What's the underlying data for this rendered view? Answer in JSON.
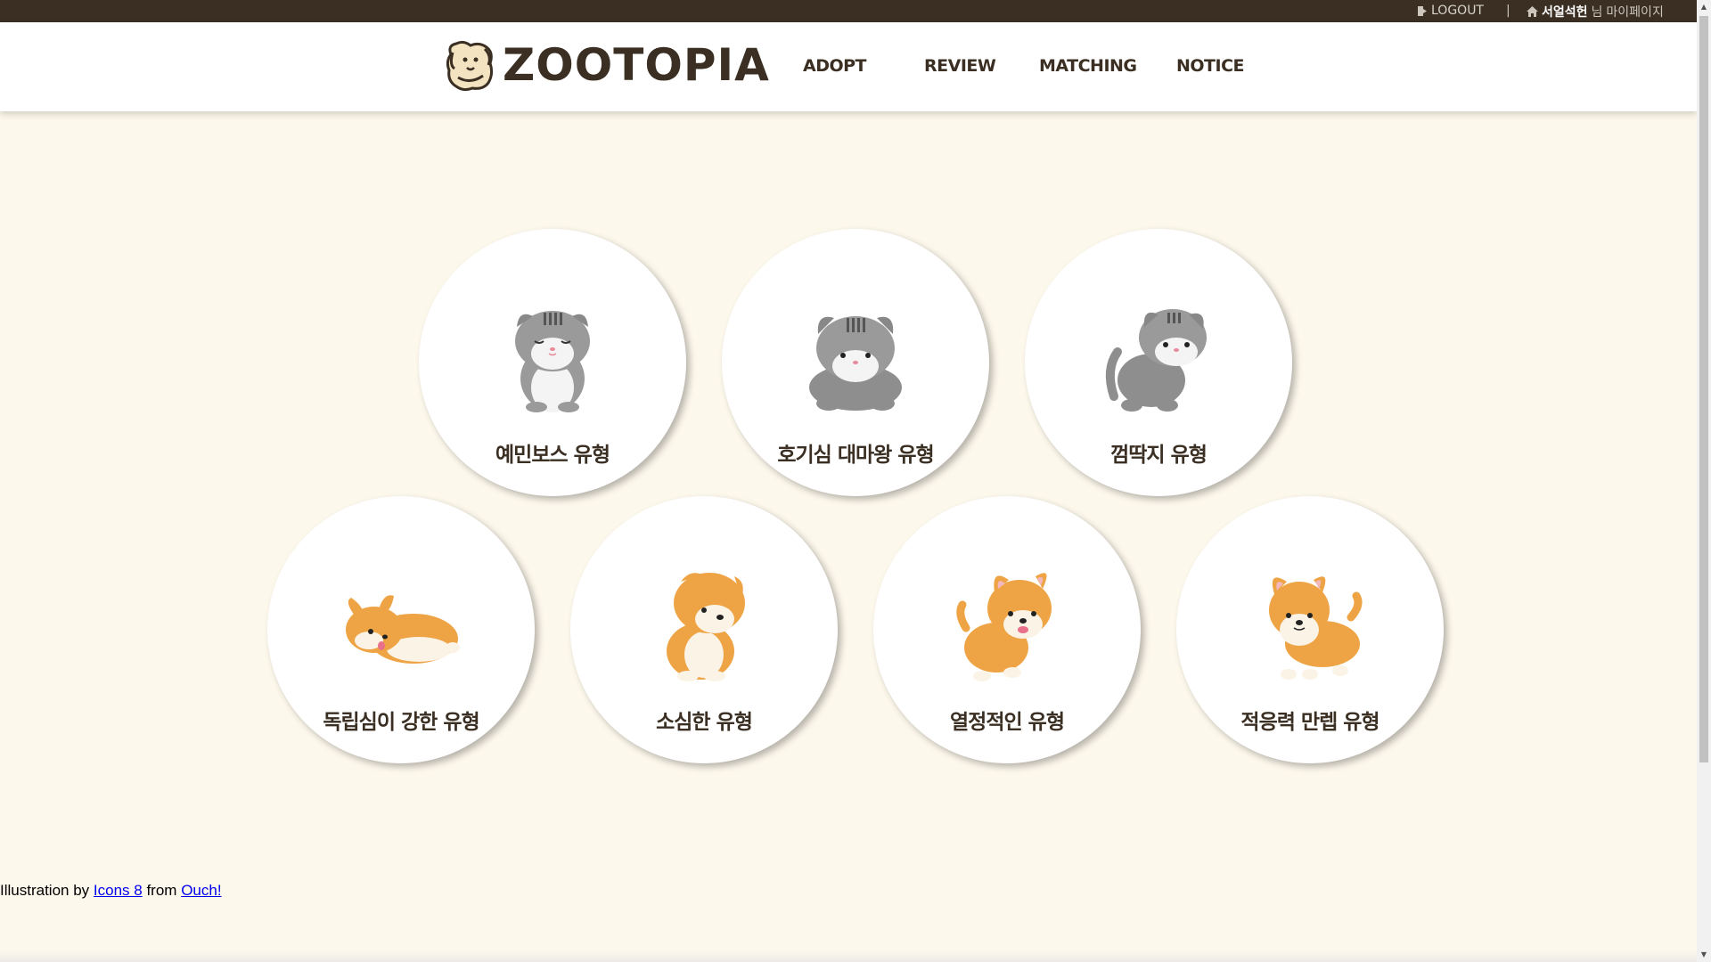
{
  "topbar": {
    "logout_label": "LOGOUT",
    "separator": "|",
    "username": "서얼석헌",
    "honorific": "님",
    "mypage_label": "마이페이지"
  },
  "header": {
    "logo_text": "ZOOTOPIA",
    "nav": [
      "ADOPT",
      "REVIEW",
      "MATCHING",
      "NOTICE"
    ]
  },
  "types": [
    {
      "label": "예민보스 유형",
      "pet": "gray-cat-sitting"
    },
    {
      "label": "호기심 대마왕 유형",
      "pet": "gray-cat-crouching"
    },
    {
      "label": "껌딱지 유형",
      "pet": "gray-cat-rolling"
    },
    {
      "label": "독립심이 강한 유형",
      "pet": "corgi-lying"
    },
    {
      "label": "소심한 유형",
      "pet": "corgi-sitting-shy"
    },
    {
      "label": "열정적인 유형",
      "pet": "corgi-jumping"
    },
    {
      "label": "적응력 만렙 유형",
      "pet": "corgi-standing"
    }
  ],
  "credit": {
    "prefix": "Illustration by",
    "link1": "Icons 8",
    "middle": "from",
    "link2": "Ouch!"
  },
  "colors": {
    "background": "#fdf8ec",
    "dark_brown": "#3a2f22",
    "cat_gray": "#8e8e8e",
    "corgi_orange": "#eea445"
  }
}
